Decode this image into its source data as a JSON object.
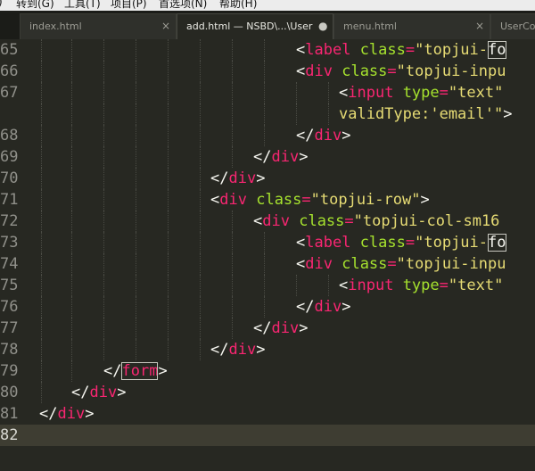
{
  "menubar": {
    "items": [
      "​)",
      "转到(G)",
      "工具(T)",
      "项目(P)",
      "首选项(N)",
      "帮助(H)"
    ]
  },
  "tabs": [
    {
      "label": "index.html",
      "close": "×",
      "active": false
    },
    {
      "label": "add.html — NSBD\\...\\User",
      "close": "●",
      "active": true
    },
    {
      "label": "menu.html",
      "close": "×",
      "active": false
    },
    {
      "label": "UserCon",
      "close": "",
      "active": false
    }
  ],
  "editor": {
    "line_numbers": [
      "65",
      "66",
      "67",
      "",
      "68",
      "69",
      "70",
      "71",
      "72",
      "73",
      "74",
      "75",
      "76",
      "77",
      "78",
      "79",
      "80",
      "81",
      "82"
    ],
    "current_line": "82",
    "lines": [
      [
        [
          "p",
          "<"
        ],
        [
          "t",
          "label"
        ],
        [
          "p",
          " "
        ],
        [
          "a",
          "class"
        ],
        [
          "o",
          "="
        ],
        [
          "s",
          "\"topjui-"
        ],
        [
          "bx",
          "fo"
        ]
      ],
      [
        [
          "p",
          "<"
        ],
        [
          "t",
          "div"
        ],
        [
          "p",
          " "
        ],
        [
          "a",
          "class"
        ],
        [
          "o",
          "="
        ],
        [
          "s",
          "\"topjui-inpu"
        ]
      ],
      [
        [
          "p",
          "<"
        ],
        [
          "t",
          "input"
        ],
        [
          "p",
          " "
        ],
        [
          "a",
          "type"
        ],
        [
          "o",
          "="
        ],
        [
          "s",
          "\"text\""
        ],
        [
          "p",
          " "
        ]
      ],
      [
        [
          "s",
          "validType:'email'\""
        ],
        [
          "p",
          ">"
        ]
      ],
      [
        [
          "p",
          "</"
        ],
        [
          "t",
          "div"
        ],
        [
          "p",
          ">"
        ]
      ],
      [
        [
          "p",
          "</"
        ],
        [
          "t",
          "div"
        ],
        [
          "p",
          ">"
        ]
      ],
      [
        [
          "p",
          "</"
        ],
        [
          "t",
          "div"
        ],
        [
          "p",
          ">"
        ]
      ],
      [
        [
          "p",
          "<"
        ],
        [
          "t",
          "div"
        ],
        [
          "p",
          " "
        ],
        [
          "a",
          "class"
        ],
        [
          "o",
          "="
        ],
        [
          "s",
          "\"topjui-row\""
        ],
        [
          "p",
          ">"
        ]
      ],
      [
        [
          "p",
          "<"
        ],
        [
          "t",
          "div"
        ],
        [
          "p",
          " "
        ],
        [
          "a",
          "class"
        ],
        [
          "o",
          "="
        ],
        [
          "s",
          "\"topjui-col-sm16"
        ]
      ],
      [
        [
          "p",
          "<"
        ],
        [
          "t",
          "label"
        ],
        [
          "p",
          " "
        ],
        [
          "a",
          "class"
        ],
        [
          "o",
          "="
        ],
        [
          "s",
          "\"topjui-"
        ],
        [
          "bx",
          "fo"
        ]
      ],
      [
        [
          "p",
          "<"
        ],
        [
          "t",
          "div"
        ],
        [
          "p",
          " "
        ],
        [
          "a",
          "class"
        ],
        [
          "o",
          "="
        ],
        [
          "s",
          "\"topjui-inpu"
        ]
      ],
      [
        [
          "p",
          "<"
        ],
        [
          "t",
          "input"
        ],
        [
          "p",
          " "
        ],
        [
          "a",
          "type"
        ],
        [
          "o",
          "="
        ],
        [
          "s",
          "\"text\""
        ],
        [
          "p",
          " "
        ]
      ],
      [
        [
          "p",
          "</"
        ],
        [
          "t",
          "div"
        ],
        [
          "p",
          ">"
        ]
      ],
      [
        [
          "p",
          "</"
        ],
        [
          "t",
          "div"
        ],
        [
          "p",
          ">"
        ]
      ],
      [
        [
          "p",
          "</"
        ],
        [
          "t",
          "div"
        ],
        [
          "p",
          ">"
        ]
      ],
      [
        [
          "p",
          "</"
        ],
        [
          "tbx",
          "form"
        ],
        [
          "p",
          ">"
        ]
      ],
      [
        [
          "p",
          "</"
        ],
        [
          "t",
          "div"
        ],
        [
          "p",
          ">"
        ]
      ],
      [
        [
          "p",
          "</"
        ],
        [
          "t",
          "div"
        ],
        [
          "p",
          ">"
        ]
      ],
      []
    ]
  },
  "colors": {
    "background": "#272822",
    "tag": "#f92672",
    "attribute": "#a6e22e",
    "string": "#e6db74",
    "punctuation": "#f8f8f2",
    "line_number": "#90908a",
    "current_line": "#3e3d32"
  }
}
